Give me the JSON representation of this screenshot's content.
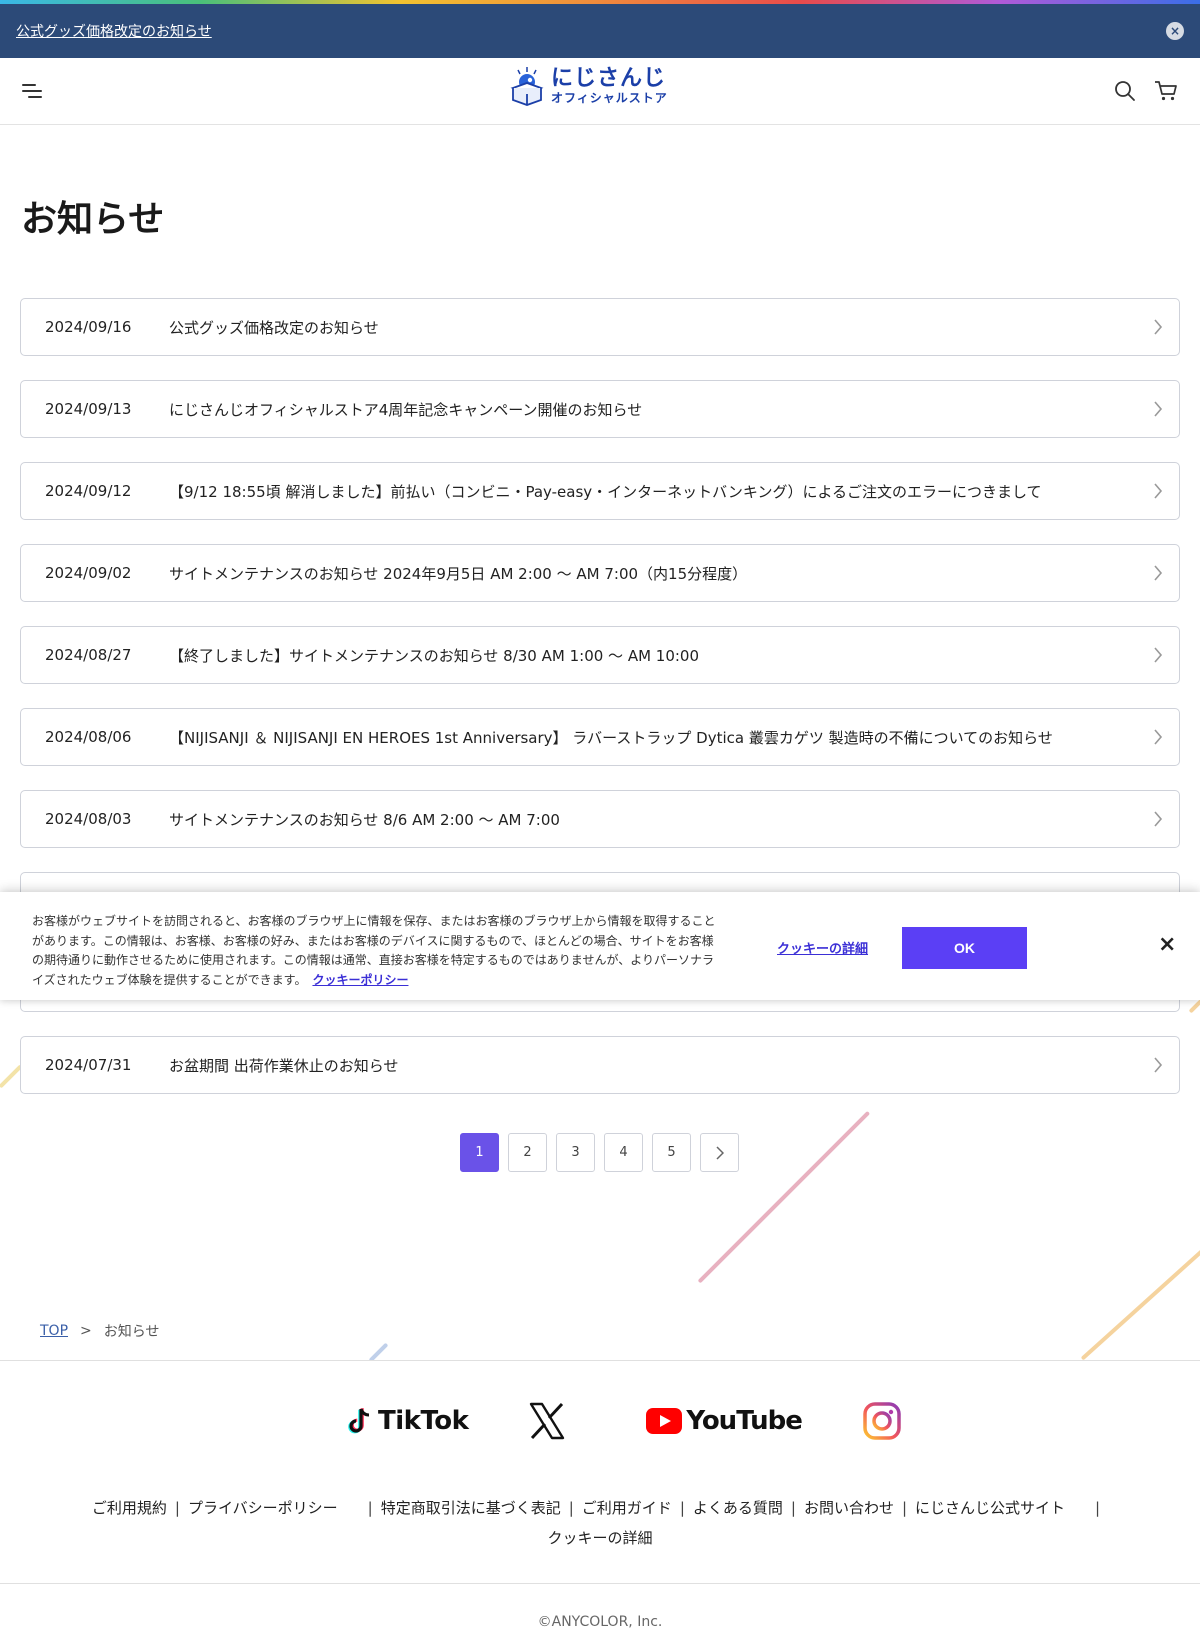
{
  "notice": {
    "text": "公式グッズ価格改定のお知らせ",
    "close": "×"
  },
  "header": {
    "logo_main": "にじさんじ",
    "logo_sub": "オフィシャルストア"
  },
  "page_title": "お知らせ",
  "news": [
    {
      "date": "2024/09/16",
      "title": "公式グッズ価格改定のお知らせ"
    },
    {
      "date": "2024/09/13",
      "title": "にじさんじオフィシャルストア4周年記念キャンペーン開催のお知らせ"
    },
    {
      "date": "2024/09/12",
      "title": "【9/12 18:55頃 解消しました】前払い（コンビニ・Pay-easy・インターネットバンキング）によるご注文のエラーにつきまして"
    },
    {
      "date": "2024/09/02",
      "title": "サイトメンテナンスのお知らせ 2024年9月5日 AM 2:00 ～ AM 7:00（内15分程度）"
    },
    {
      "date": "2024/08/27",
      "title": "【終了しました】サイトメンテナンスのお知らせ 8/30 AM 1:00 ～ AM 10:00"
    },
    {
      "date": "2024/08/06",
      "title": "【NIJISANJI ＆ NIJISANJI EN HEROES 1st Anniversary】 ラバーストラップ Dytica 叢雲カゲツ 製造時の不備についてのお知らせ"
    },
    {
      "date": "2024/08/03",
      "title": "サイトメンテナンスのお知らせ 8/6 AM 2:00 ～ AM 7:00"
    },
    {
      "date": "",
      "title": ""
    },
    {
      "date": "",
      "title": ""
    },
    {
      "date": "2024/07/31",
      "title": "お盆期間 出荷作業休止のお知らせ"
    }
  ],
  "cookie": {
    "text": "お客様がウェブサイトを訪問されると、お客様のブラウザ上に情報を保存、またはお客様のブラウザ上から情報を取得することがあります。この情報は、お客様、お客様の好み、またはお客様のデバイスに関するもので、ほとんどの場合、サイトをお客様の期待通りに動作させるために使用されます。この情報は通常、直接お客様を特定するものではありませんが、よりパーソナライズされたウェブ体験を提供することができます。",
    "policy_link": "クッキーポリシー",
    "details_link": "クッキーの詳細",
    "ok_label": "OK",
    "close": "×"
  },
  "pagination": {
    "pages": [
      "1",
      "2",
      "3",
      "4",
      "5"
    ],
    "current": "1"
  },
  "breadcrumb": {
    "top": "TOP",
    "sep": ">",
    "current": "お知らせ"
  },
  "footer": {
    "tiktok": "TikTok",
    "youtube": "YouTube",
    "links": [
      "ご利用規約",
      "プライバシーポリシー",
      "特定商取引法に基づく表記",
      "ご利用ガイド",
      "よくある質問",
      "お問い合わせ",
      "にじさんじ公式サイト",
      "クッキーの詳細"
    ],
    "separator": "|",
    "copyright": "©ANYCOLOR, Inc."
  },
  "colors": {
    "notice_bg": "#2c4a78",
    "accent": "#6a52e8",
    "cookie_ok": "#5b3ff5",
    "brand_blue": "#1b3fa8"
  }
}
